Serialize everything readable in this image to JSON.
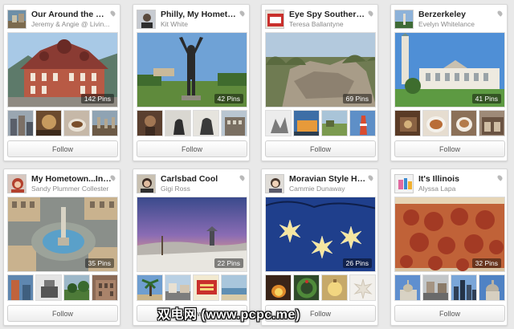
{
  "follow_label": "Follow",
  "boards": [
    {
      "title": "Our Around the Wor...",
      "owner": "Jeremy & Angie @ Livin...",
      "pins": "142 Pins",
      "cover_icon": "monastery-photo",
      "thumb_icons": [
        "city-photo",
        "interior-photo",
        "coffee-photo",
        "ruins-photo"
      ]
    },
    {
      "title": "Philly, My Hometown",
      "owner": "Kit White",
      "pins": "42 Pins",
      "cover_icon": "rocky-statue-photo",
      "thumb_icons": [
        "sculpture-photo",
        "thinker-photo",
        "bronze-photo",
        "building-photo"
      ]
    },
    {
      "title": "Eye Spy Southern Ill...",
      "owner": "Teresa Ballantyne",
      "pins": "69 Pins",
      "cover_icon": "rock-formation-photo",
      "thumb_icons": [
        "painting-photo",
        "sign-photo",
        "landscape-photo",
        "lighthouse-photo"
      ]
    },
    {
      "title": "Berzerkeley",
      "owner": "Evelyn Whitelance",
      "pins": "41 Pins",
      "cover_icon": "campus-tower-photo",
      "thumb_icons": [
        "restaurant-photo",
        "food-photo",
        "cup-photo",
        "storefront-photo"
      ]
    },
    {
      "title": "My Hometown...India...",
      "owner": "Sandy Plummer Collester",
      "pins": "35 Pins",
      "cover_icon": "monument-circle-photo",
      "thumb_icons": [
        "bridge-photo",
        "memorial-photo",
        "park-photo",
        "building-photo"
      ]
    },
    {
      "title": "Carlsbad Cool",
      "owner": "Gigi Ross",
      "pins": "22 Pins",
      "cover_icon": "beach-sunset-photo",
      "thumb_icons": [
        "palm-photo",
        "street-photo",
        "sign-photo",
        "shore-photo"
      ]
    },
    {
      "title": "Moravian Style Holi...",
      "owner": "Cammie Dunaway",
      "pins": "26 Pins",
      "cover_icon": "star-lanterns-photo",
      "thumb_icons": [
        "fire-photo",
        "wreath-photo",
        "ornament-photo",
        "star-photo"
      ]
    },
    {
      "title": "It's Illinois",
      "owner": "Alyssa Lapa",
      "pins": "32 Pins",
      "cover_icon": "pizza-photo",
      "thumb_icons": [
        "capitol-photo",
        "street-photo",
        "skyline-photo",
        "dome-photo"
      ]
    }
  ],
  "watermark": "双电网 (www.pcpc.me)"
}
